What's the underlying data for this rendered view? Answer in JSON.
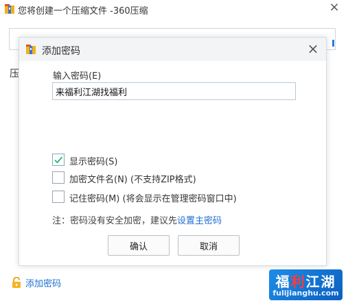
{
  "parent": {
    "title": "您将创建一个压缩文件 -360压缩",
    "close_glyph": "×",
    "left_label": "压",
    "add_password_link": "添加密码",
    "app_icon": "archive-icon",
    "lock_icon": "lock-icon"
  },
  "dialog": {
    "title": "添加密码",
    "close_glyph": "×",
    "password_label": "输入密码(E)",
    "password_value": "来福利江湖找福利",
    "options": [
      {
        "label": "显示密码(S)",
        "checked": true
      },
      {
        "label": "加密文件名(N) (不支持ZIP格式)",
        "checked": false
      },
      {
        "label": "记住密码(M) (将会显示在管理密码窗口中)",
        "checked": false
      }
    ],
    "note_prefix": "注：密码没有安全加密，建议先",
    "note_link": "设置主密码",
    "ok_label": "确认",
    "cancel_label": "取消"
  },
  "watermark": {
    "text_part1": "福",
    "text_part2": "利",
    "text_part3": "江湖",
    "url": "fulijianghu.com"
  },
  "colors": {
    "accent": "#1e6fd0",
    "titlebar": "#f2f4f6",
    "check": "#2fb36d"
  }
}
